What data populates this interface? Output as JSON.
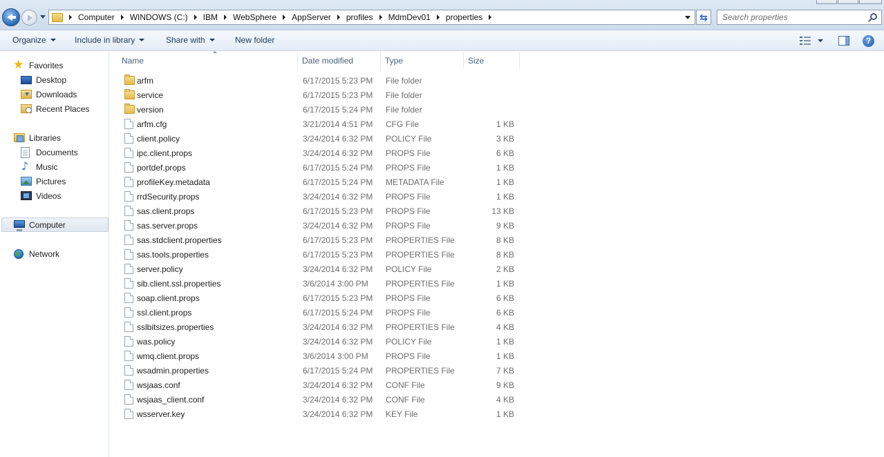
{
  "address": {
    "breadcrumbs": [
      "Computer",
      "WINDOWS (C:)",
      "IBM",
      "WebSphere",
      "AppServer",
      "profiles",
      "MdmDev01",
      "properties"
    ]
  },
  "search": {
    "placeholder": "Search properties"
  },
  "toolbar": {
    "organize": "Organize",
    "include_in_library": "Include in library",
    "share_with": "Share with",
    "new_folder": "New folder"
  },
  "nav": {
    "favorites": "Favorites",
    "desktop": "Desktop",
    "downloads": "Downloads",
    "recent_places": "Recent Places",
    "libraries": "Libraries",
    "documents": "Documents",
    "music": "Music",
    "pictures": "Pictures",
    "videos": "Videos",
    "computer": "Computer",
    "network": "Network"
  },
  "columns": {
    "name": "Name",
    "date": "Date modified",
    "type": "Type",
    "size": "Size"
  },
  "files": [
    {
      "name": "arfm",
      "date": "6/17/2015 5:23 PM",
      "type": "File folder",
      "size": "",
      "kind": "folder"
    },
    {
      "name": "service",
      "date": "6/17/2015 5:23 PM",
      "type": "File folder",
      "size": "",
      "kind": "folder"
    },
    {
      "name": "version",
      "date": "6/17/2015 5:24 PM",
      "type": "File folder",
      "size": "",
      "kind": "folder"
    },
    {
      "name": "arfm.cfg",
      "date": "3/21/2014 4:51 PM",
      "type": "CFG File",
      "size": "1 KB",
      "kind": "file"
    },
    {
      "name": "client.policy",
      "date": "3/24/2014 6:32 PM",
      "type": "POLICY File",
      "size": "3 KB",
      "kind": "file"
    },
    {
      "name": "ipc.client.props",
      "date": "3/24/2014 6:32 PM",
      "type": "PROPS File",
      "size": "6 KB",
      "kind": "file"
    },
    {
      "name": "portdef.props",
      "date": "6/17/2015 5:24 PM",
      "type": "PROPS File",
      "size": "1 KB",
      "kind": "file"
    },
    {
      "name": "profileKey.metadata",
      "date": "6/17/2015 5:24 PM",
      "type": "METADATA File",
      "size": "1 KB",
      "kind": "file"
    },
    {
      "name": "rrdSecurity.props",
      "date": "3/24/2014 6:32 PM",
      "type": "PROPS File",
      "size": "1 KB",
      "kind": "file"
    },
    {
      "name": "sas.client.props",
      "date": "6/17/2015 5:23 PM",
      "type": "PROPS File",
      "size": "13 KB",
      "kind": "file"
    },
    {
      "name": "sas.server.props",
      "date": "3/24/2014 6:32 PM",
      "type": "PROPS File",
      "size": "9 KB",
      "kind": "file"
    },
    {
      "name": "sas.stdclient.properties",
      "date": "6/17/2015 5:23 PM",
      "type": "PROPERTIES File",
      "size": "8 KB",
      "kind": "file"
    },
    {
      "name": "sas.tools.properties",
      "date": "6/17/2015 5:23 PM",
      "type": "PROPERTIES File",
      "size": "8 KB",
      "kind": "file"
    },
    {
      "name": "server.policy",
      "date": "3/24/2014 6:32 PM",
      "type": "POLICY File",
      "size": "2 KB",
      "kind": "file"
    },
    {
      "name": "sib.client.ssl.properties",
      "date": "3/6/2014 3:00 PM",
      "type": "PROPERTIES File",
      "size": "1 KB",
      "kind": "file"
    },
    {
      "name": "soap.client.props",
      "date": "6/17/2015 5:23 PM",
      "type": "PROPS File",
      "size": "6 KB",
      "kind": "file"
    },
    {
      "name": "ssl.client.props",
      "date": "6/17/2015 5:24 PM",
      "type": "PROPS File",
      "size": "6 KB",
      "kind": "file"
    },
    {
      "name": "sslbitsizes.properties",
      "date": "3/24/2014 6:32 PM",
      "type": "PROPERTIES File",
      "size": "4 KB",
      "kind": "file"
    },
    {
      "name": "was.policy",
      "date": "3/24/2014 6:32 PM",
      "type": "POLICY File",
      "size": "1 KB",
      "kind": "file"
    },
    {
      "name": "wmq.client.props",
      "date": "3/6/2014 3:00 PM",
      "type": "PROPS File",
      "size": "1 KB",
      "kind": "file"
    },
    {
      "name": "wsadmin.properties",
      "date": "6/17/2015 5:24 PM",
      "type": "PROPERTIES File",
      "size": "7 KB",
      "kind": "file"
    },
    {
      "name": "wsjaas.conf",
      "date": "3/24/2014 6:32 PM",
      "type": "CONF File",
      "size": "9 KB",
      "kind": "file"
    },
    {
      "name": "wsjaas_client.conf",
      "date": "3/24/2014 6:32 PM",
      "type": "CONF File",
      "size": "4 KB",
      "kind": "file"
    },
    {
      "name": "wsserver.key",
      "date": "3/24/2014 6:32 PM",
      "type": "KEY File",
      "size": "1 KB",
      "kind": "file"
    }
  ]
}
